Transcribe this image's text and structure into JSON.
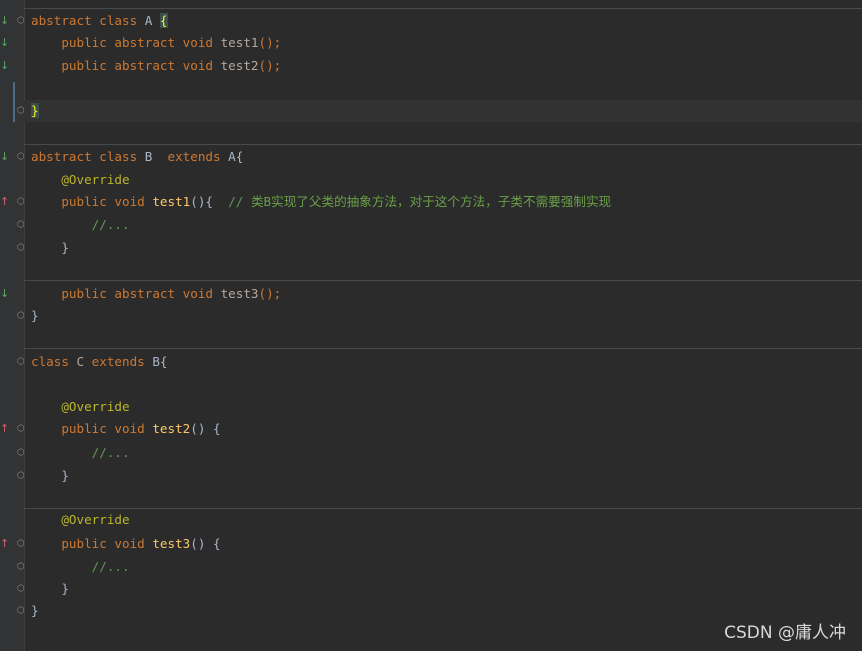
{
  "editor": {
    "lines": [
      {
        "id": "l1",
        "tokens": [
          [
            "kw",
            "abstract class "
          ],
          [
            "id",
            "A "
          ],
          [
            "brace",
            "{"
          ]
        ]
      },
      {
        "id": "l2",
        "tokens": [
          [
            "sp",
            "    "
          ],
          [
            "kw",
            "public abstract void "
          ],
          [
            "ab",
            "test1"
          ],
          [
            "pn",
            "();"
          ]
        ]
      },
      {
        "id": "l3",
        "tokens": [
          [
            "sp",
            "    "
          ],
          [
            "kw",
            "public abstract void "
          ],
          [
            "ab",
            "test2"
          ],
          [
            "pn",
            "();"
          ]
        ]
      },
      {
        "id": "l4",
        "tokens": []
      },
      {
        "id": "l5",
        "tokens": [
          [
            "brace",
            "}"
          ]
        ]
      },
      {
        "id": "l6",
        "tokens": [
          [
            "kw",
            "abstract class "
          ],
          [
            "id",
            "B  "
          ],
          [
            "kw",
            "extends "
          ],
          [
            "id",
            "A{"
          ]
        ]
      },
      {
        "id": "l7",
        "tokens": [
          [
            "sp",
            "    "
          ],
          [
            "an",
            "@Override"
          ]
        ]
      },
      {
        "id": "l8",
        "tokens": [
          [
            "sp",
            "    "
          ],
          [
            "kw",
            "public void "
          ],
          [
            "fn",
            "test1"
          ],
          [
            "id",
            "(){  "
          ],
          [
            "cm",
            "// "
          ],
          [
            "cj",
            "类B实现了父类的抽象方法，对于这个方法，子类不需要强制实现"
          ]
        ]
      },
      {
        "id": "l9",
        "tokens": [
          [
            "sp",
            "        "
          ],
          [
            "cm",
            "//..."
          ]
        ]
      },
      {
        "id": "l10",
        "tokens": [
          [
            "sp",
            "    "
          ],
          [
            "id",
            "}"
          ]
        ]
      },
      {
        "id": "l11",
        "tokens": [
          [
            "sp",
            "    "
          ],
          [
            "kw",
            "public abstract void "
          ],
          [
            "ab",
            "test3"
          ],
          [
            "pn",
            "();"
          ]
        ]
      },
      {
        "id": "l12",
        "tokens": [
          [
            "id",
            "}"
          ]
        ]
      },
      {
        "id": "l13",
        "tokens": [
          [
            "kw",
            "class "
          ],
          [
            "ab",
            "C "
          ],
          [
            "kw",
            "extends "
          ],
          [
            "id",
            "B{"
          ]
        ]
      },
      {
        "id": "l14",
        "tokens": [
          [
            "sp",
            "    "
          ],
          [
            "an",
            "@Override"
          ]
        ]
      },
      {
        "id": "l15",
        "tokens": [
          [
            "sp",
            "    "
          ],
          [
            "kw",
            "public void "
          ],
          [
            "fn",
            "test2"
          ],
          [
            "id",
            "() {"
          ]
        ]
      },
      {
        "id": "l16",
        "tokens": [
          [
            "sp",
            "        "
          ],
          [
            "cm",
            "//..."
          ]
        ]
      },
      {
        "id": "l17",
        "tokens": [
          [
            "sp",
            "    "
          ],
          [
            "id",
            "}"
          ]
        ]
      },
      {
        "id": "l18",
        "tokens": [
          [
            "sp",
            "    "
          ],
          [
            "an",
            "@Override"
          ]
        ]
      },
      {
        "id": "l19",
        "tokens": [
          [
            "sp",
            "    "
          ],
          [
            "kw",
            "public void "
          ],
          [
            "fn",
            "test3"
          ],
          [
            "id",
            "() {"
          ]
        ]
      },
      {
        "id": "l20",
        "tokens": [
          [
            "sp",
            "        "
          ],
          [
            "cm",
            "//..."
          ]
        ]
      },
      {
        "id": "l21",
        "tokens": [
          [
            "sp",
            "    "
          ],
          [
            "id",
            "}"
          ]
        ]
      },
      {
        "id": "l22",
        "tokens": [
          [
            "id",
            "}"
          ]
        ]
      }
    ],
    "gutter_icons": {
      "l1": "implemented-down-icon",
      "l2": "implemented-down-icon",
      "l3": "implemented-down-icon",
      "l6": "implemented-down-icon",
      "l8": "overrides-up-icon",
      "l11": "implemented-down-icon",
      "l15": "overrides-up-icon",
      "l19": "overrides-up-icon"
    }
  },
  "watermark": {
    "text": "CSDN @庸人冲"
  },
  "colors": {
    "background": "#2b2b2b",
    "keyword": "#cc7832",
    "identifier": "#a9b7c6",
    "method": "#ffc66d",
    "abstract_method": "#b1a8a2",
    "annotation": "#bbb529",
    "comment": "#629755"
  }
}
